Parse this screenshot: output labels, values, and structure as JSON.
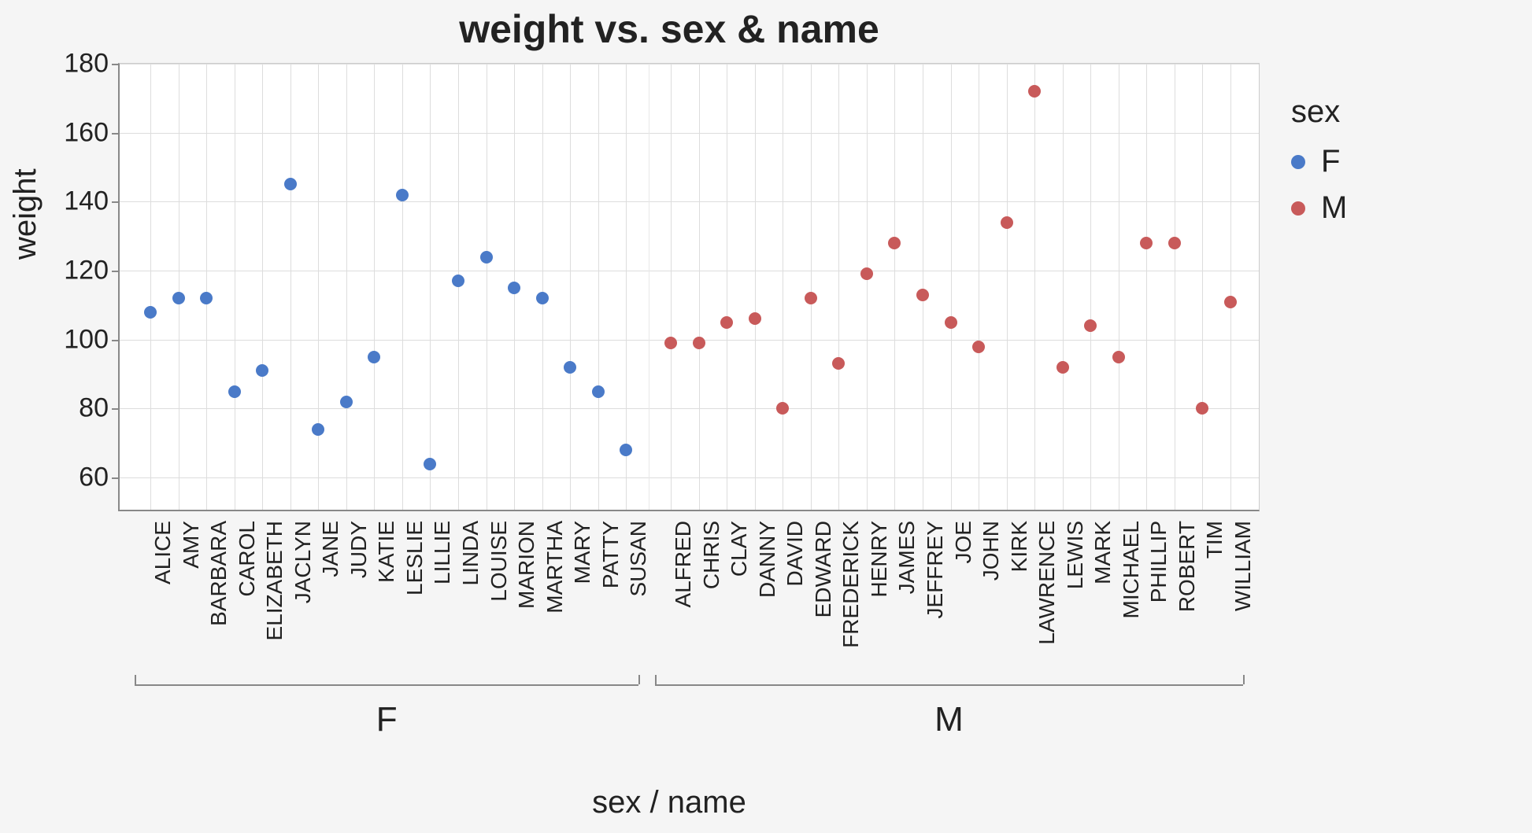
{
  "chart_data": {
    "type": "scatter",
    "title": "weight vs. sex & name",
    "xlabel": "sex / name",
    "ylabel": "weight",
    "ylim": [
      50,
      180
    ],
    "yticks": [
      60,
      80,
      100,
      120,
      140,
      160,
      180
    ],
    "legend_title": "sex",
    "legend_items": [
      "F",
      "M"
    ],
    "groups": [
      {
        "sex": "F",
        "points": [
          {
            "name": "ALICE",
            "weight": 108
          },
          {
            "name": "AMY",
            "weight": 112
          },
          {
            "name": "BARBARA",
            "weight": 112
          },
          {
            "name": "CAROL",
            "weight": 85
          },
          {
            "name": "ELIZABETH",
            "weight": 91
          },
          {
            "name": "JACLYN",
            "weight": 145
          },
          {
            "name": "JANE",
            "weight": 74
          },
          {
            "name": "JUDY",
            "weight": 82
          },
          {
            "name": "KATIE",
            "weight": 95
          },
          {
            "name": "LESLIE",
            "weight": 142
          },
          {
            "name": "LILLIE",
            "weight": 64
          },
          {
            "name": "LINDA",
            "weight": 117
          },
          {
            "name": "LOUISE",
            "weight": 124
          },
          {
            "name": "MARION",
            "weight": 115
          },
          {
            "name": "MARTHA",
            "weight": 112
          },
          {
            "name": "MARY",
            "weight": 92
          },
          {
            "name": "PATTY",
            "weight": 85
          },
          {
            "name": "SUSAN",
            "weight": 68
          }
        ]
      },
      {
        "sex": "M",
        "points": [
          {
            "name": "ALFRED",
            "weight": 99
          },
          {
            "name": "CHRIS",
            "weight": 99
          },
          {
            "name": "CLAY",
            "weight": 105
          },
          {
            "name": "DANNY",
            "weight": 106
          },
          {
            "name": "DAVID",
            "weight": 80
          },
          {
            "name": "EDWARD",
            "weight": 112
          },
          {
            "name": "FREDERICK",
            "weight": 93
          },
          {
            "name": "HENRY",
            "weight": 119
          },
          {
            "name": "JAMES",
            "weight": 128
          },
          {
            "name": "JEFFREY",
            "weight": 113
          },
          {
            "name": "JOE",
            "weight": 105
          },
          {
            "name": "JOHN",
            "weight": 98
          },
          {
            "name": "KIRK",
            "weight": 134
          },
          {
            "name": "LAWRENCE",
            "weight": 172
          },
          {
            "name": "LEWIS",
            "weight": 92
          },
          {
            "name": "MARK",
            "weight": 104
          },
          {
            "name": "MICHAEL",
            "weight": 95
          },
          {
            "name": "PHILLIP",
            "weight": 128
          },
          {
            "name": "ROBERT",
            "weight": 128
          },
          {
            "name": "TIM",
            "weight": 80
          },
          {
            "name": "WILLIAM",
            "weight": 111
          }
        ]
      }
    ],
    "colors": {
      "F": "#4a7ac8",
      "M": "#c85a5a"
    }
  }
}
